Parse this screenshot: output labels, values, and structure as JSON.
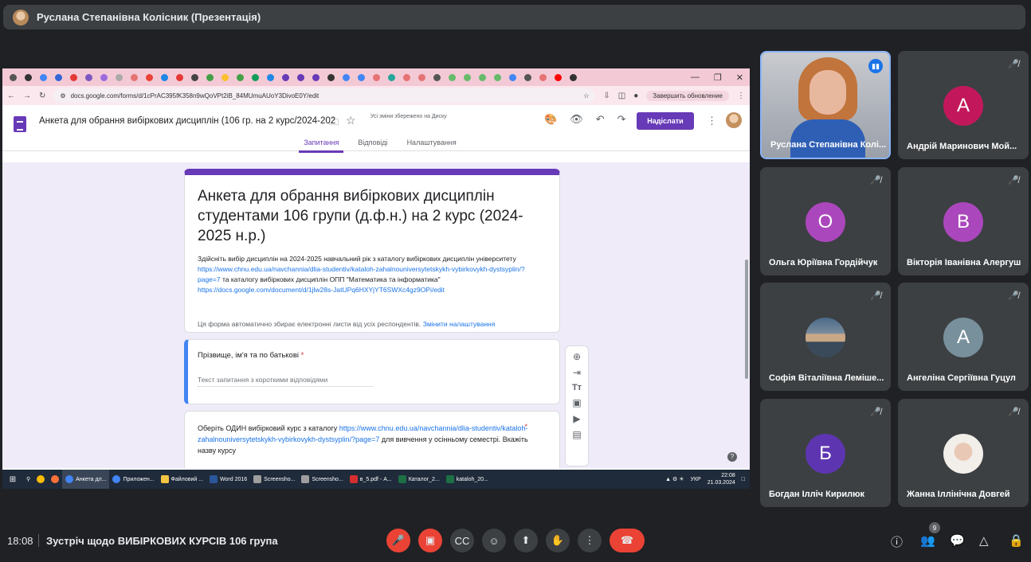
{
  "presenter": {
    "name": "Руслана Степанівна Колісник (Презентація)"
  },
  "browser": {
    "url": "docs.google.com/forms/d/1cPrAC395fK358n9wQoVPt2iB_84MUmuAUoY3DivoE0Y/edit",
    "update_label": "Завершить обновление"
  },
  "form": {
    "header_title": "Анкета для обрання вибіркових дисциплін  (106 гр. на 2 курс/2024-202",
    "saved_note": "Усі зміни збережено на Диску",
    "send_label": "Надіслати",
    "tabs": [
      "Запитання",
      "Відповіді",
      "Налаштування"
    ],
    "title": "Анкета для обрання вибіркових дисциплін студентами 106 групи (д.ф.н.) на 2 курс  (2024-2025 н.р.)",
    "desc_part1": "Здійсніть вибір дисциплін на 2024-2025 навчальний рік з каталогу вибіркових дисциплін університету ",
    "desc_link1": "https://www.chnu.edu.ua/navchannia/dlia-studentiv/kataloh-zahalnouniversytetskykh-vybirkovykh-dystsyplin/?page=7",
    "desc_part2": " та каталогу вибіркових дисциплін ОПП \"Математика та інформатика\" ",
    "desc_link2": "https://docs.google.com/document/d/1jlw28s-JatUPq6HXYjYT6SWXc4gz9OPi/edit",
    "autocollect_text": "Ця форма автоматично збирає електронні листи від усіх респондентів.",
    "autocollect_link": "Змінити налаштування",
    "q1_label": "Прізвище, ім'я та по батькові",
    "q1_hint": "Текст запитання з короткими відповідями",
    "q2_part1": "Оберіть ОДИН вибірковий курс з каталогу  ",
    "q2_link": "https://www.chnu.edu.ua/navchannia/dlia-studentiv/kataloh-zahalnouniversytetskykh-vybirkovykh-dystsyplin/?page=7",
    "q2_part2": "   для вивчення у осінньому семестрі. Вкажіть  назву курсу",
    "required_mark": "*"
  },
  "taskbar": {
    "items": [
      "Анкета дл...",
      "Приложен...",
      "Файловий ...",
      "Word 2016",
      "Screensho...",
      "Screensho...",
      "в_5.pdf - А...",
      "Каталог_2...",
      "kataloh_20..."
    ],
    "lang": "УКР",
    "time": "22:08",
    "date": "21.03.2024"
  },
  "participants": [
    {
      "name": "Руслана Степанівна Колі...",
      "type": "video"
    },
    {
      "name": "Андрій Маринович Мой...",
      "letter": "А",
      "color": "#c2185b"
    },
    {
      "name": "Ольга Юріївна Гордійчук",
      "letter": "О",
      "color": "#ab47bc"
    },
    {
      "name": "Вікторія Іванівна Алергуш",
      "letter": "В",
      "color": "#ab47bc"
    },
    {
      "name": "Софія Віталіївна Лемішe...",
      "type": "photo"
    },
    {
      "name": "Ангеліна Сергіївна Гуцул",
      "letter": "А",
      "color": "#78909c"
    },
    {
      "name": "Богдан Ілліч Кирилюк",
      "letter": "Б",
      "color": "#5e35b1"
    },
    {
      "name": "Жанна Іллінічна Довгей",
      "type": "photo"
    }
  ],
  "meeting": {
    "time": "18:08",
    "title": "Зустріч щодо ВИБІРКОВИХ КУРСІВ 106 група",
    "people_count": "9"
  }
}
